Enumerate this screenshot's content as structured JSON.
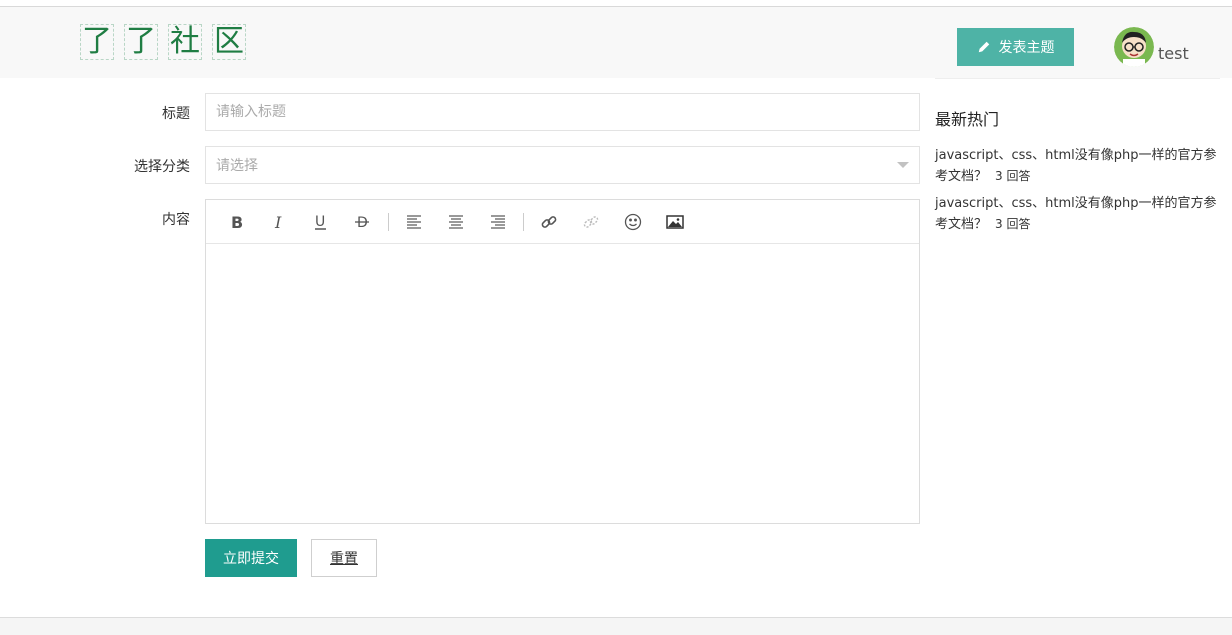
{
  "header": {
    "logo_chars": [
      "了",
      "了",
      "社",
      "区"
    ],
    "post_button_label": "发表主题",
    "username": "test"
  },
  "form": {
    "title_label": "标题",
    "title_placeholder": "请输入标题",
    "category_label": "选择分类",
    "category_placeholder": "请选择",
    "content_label": "内容",
    "toolbar_icons": [
      "bold-icon",
      "italic-icon",
      "underline-icon",
      "strikethrough-icon",
      "align-left-icon",
      "align-center-icon",
      "align-right-icon",
      "link-icon",
      "unlink-icon",
      "emoji-icon",
      "image-icon"
    ],
    "submit_label": "立即提交",
    "reset_label": "重置"
  },
  "sidebar": {
    "title": "最新热门",
    "items": [
      {
        "text": "javascript、css、html没有像php一样的官方参考文档？",
        "count": "3 回答"
      },
      {
        "text": "javascript、css、html没有像php一样的官方参考文档？",
        "count": "3 回答"
      }
    ]
  },
  "colors": {
    "accent": "#1f9c8f",
    "post_button": "#4eb3a6",
    "logo": "#1f7d43"
  }
}
